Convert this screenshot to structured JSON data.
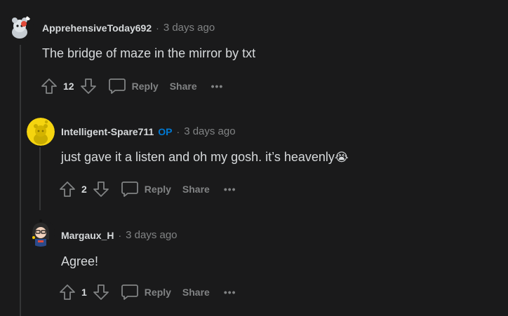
{
  "comments": [
    {
      "author": "ApprehensiveToday692",
      "op_badge": "",
      "time": "3 days ago",
      "text": "The bridge of maze in the mirror by txt",
      "votes": "12"
    },
    {
      "author": "Intelligent-Spare711",
      "op_badge": "OP",
      "time": "3 days ago",
      "text": "just gave it a listen and oh my gosh. it’s heavenly",
      "emoji": "😭",
      "votes": "2"
    },
    {
      "author": "Margaux_H",
      "op_badge": "",
      "time": "3 days ago",
      "text": "Agree!",
      "votes": "1"
    }
  ],
  "actions": {
    "reply": "Reply",
    "share": "Share",
    "more": "•••"
  },
  "separator": "·",
  "colors": {
    "background": "#1a1a1b",
    "op_badge": "#0079d3",
    "muted": "#818384",
    "text": "#d7dadc"
  }
}
